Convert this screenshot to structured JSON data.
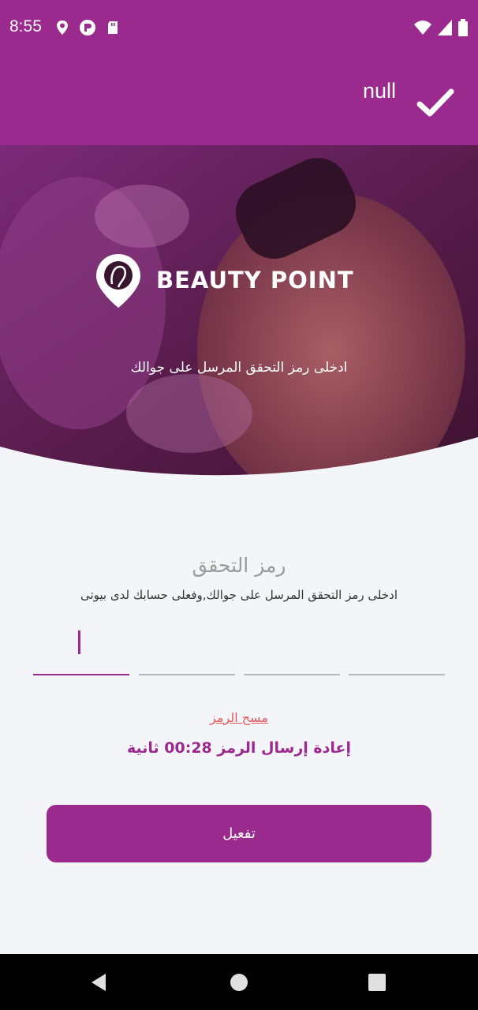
{
  "status_bar": {
    "time": "8:55",
    "left_icons": [
      "location-icon",
      "app-icon",
      "sd-card-icon"
    ],
    "right_icons": [
      "wifi-icon",
      "signal-icon",
      "battery-icon"
    ]
  },
  "app_bar": {
    "title": "null",
    "action_icon": "check-icon",
    "background_color": "#9b2a8e"
  },
  "hero": {
    "logo_text": "BEAUTY POINT",
    "logo_icon": "location-pin-icon",
    "subtitle": "ادخلى رمز التحقق المرسل على جوالك"
  },
  "form": {
    "title": "رمز التحقق",
    "instruction": "ادخلى رمز التحقق المرسل على جوالك,وفعلى حسابك لدى بيوتى",
    "otp_digits": [
      "",
      "",
      "",
      ""
    ],
    "clear_label": "مسح الرمز",
    "resend_text": "إعادة إرسال الرمز 00:28 ثانية",
    "activate_label": "تفعيل",
    "accent_color": "#9b2a8e",
    "clear_color": "#e05a5a"
  },
  "nav_bar": {
    "buttons": [
      "back-icon",
      "home-icon",
      "recents-icon"
    ]
  }
}
